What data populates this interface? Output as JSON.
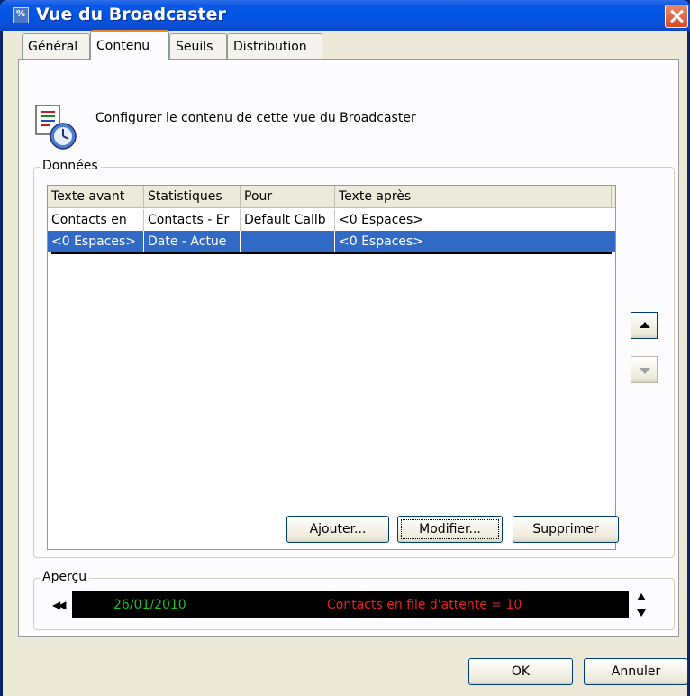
{
  "window": {
    "title": "Vue du Broadcaster"
  },
  "tabs": [
    {
      "label": "Général"
    },
    {
      "label": "Contenu"
    },
    {
      "label": "Seuils"
    },
    {
      "label": "Distribution"
    }
  ],
  "header": {
    "text": "Configurer le contenu de cette vue du Broadcaster"
  },
  "data_group": {
    "label": "Données",
    "columns": [
      "Texte avant",
      "Statistiques",
      "Pour",
      "Texte après"
    ],
    "rows": [
      [
        "Contacts en",
        "Contacts - Er",
        "Default Callb",
        "<0 Espaces>"
      ],
      [
        "<0 Espaces>",
        "Date - Actue",
        "",
        "<0 Espaces>"
      ]
    ],
    "buttons": {
      "add": "Ajouter...",
      "modify": "Modifier...",
      "delete": "Supprimer"
    }
  },
  "preview_group": {
    "label": "Aperçu",
    "date": "26/01/2010",
    "message": "Contacts en file d'attente = 10"
  },
  "footer": {
    "ok": "OK",
    "cancel": "Annuler"
  },
  "colors": {
    "selection": "#316ac5",
    "preview_date": "#1fc11f",
    "preview_message": "#e42222"
  },
  "icons": {
    "title": "app-icon",
    "close": "close-icon",
    "header": "document-clock-icon",
    "move_up": "triangle-up-icon",
    "move_down": "triangle-down-icon",
    "rewind": "rewind-icon",
    "spin": "spin-arrows-icon"
  }
}
